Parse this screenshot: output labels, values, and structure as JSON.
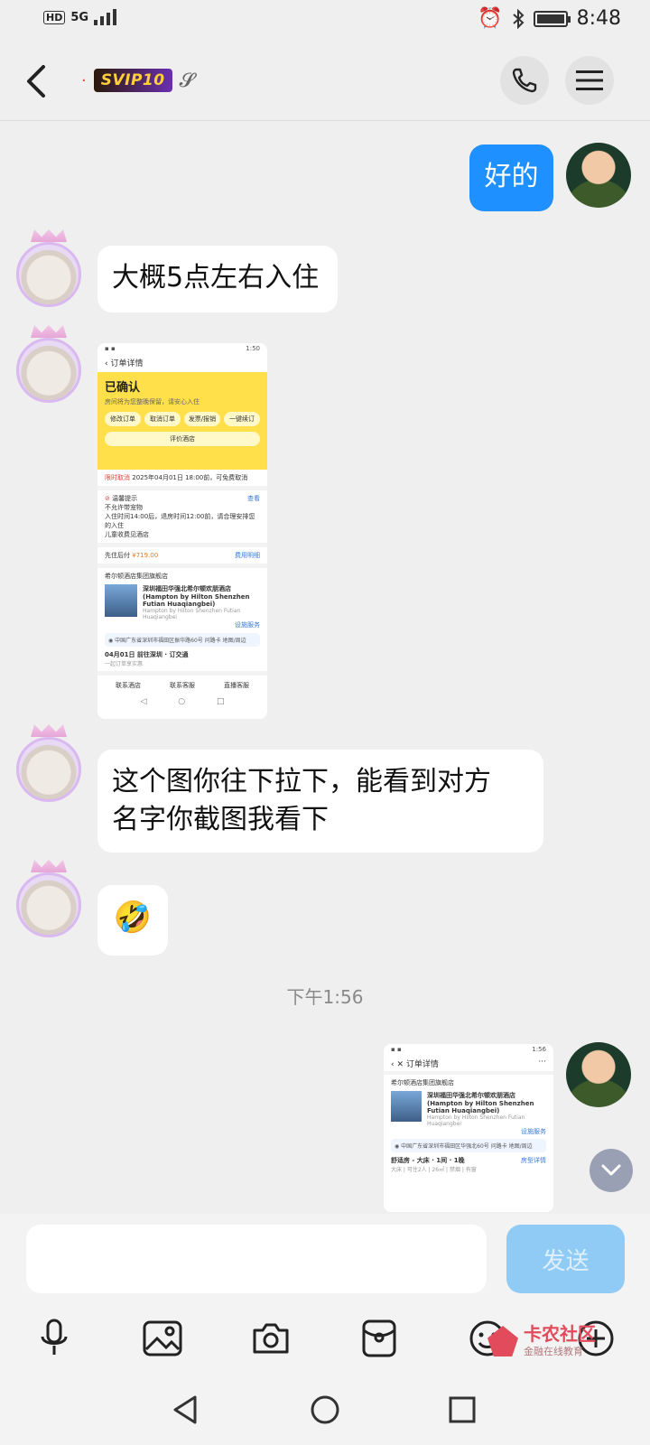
{
  "status_bar": {
    "network": "HD",
    "signal": "5G",
    "time": "8:48",
    "battery_level": 0.9
  },
  "header": {
    "badge_text": "SVIP10",
    "badge_dot": "·"
  },
  "messages": [
    {
      "sender": "me",
      "text": "好的"
    },
    {
      "sender": "them",
      "text": "大概5点左右入住"
    },
    {
      "sender": "them",
      "type": "image"
    },
    {
      "sender": "them",
      "text_line1": "这个图你往下拉下，能看到对方",
      "text_line2": "名字你截图我看下"
    },
    {
      "sender": "them",
      "type": "emoji",
      "emoji": "🤣"
    }
  ],
  "timestamp": "下午1:56",
  "shot1": {
    "time": "1:50",
    "title": "订单详情",
    "status": "已确认",
    "note": "房间将为您整晚保留，请安心入住",
    "buttons": [
      "修改订单",
      "取消订单",
      "发票/报销",
      "一键续订"
    ],
    "review": "评价酒店",
    "cancel_label": "限时取消",
    "cancel_text": "2025年04月01日 18:00前，可免费取消",
    "tips_title": "温馨提示",
    "tips_more": "查看",
    "tip1": "不允许带宠物",
    "tip2": "入住时间14:00后，退房时间12:00前，请合理安排您的入住",
    "tip3": "儿童收费见酒店",
    "pay_label": "先住后付",
    "price": "¥719.00",
    "price_detail": "费用明细",
    "group": "希尔顿酒店集团旗舰店",
    "hotel_cn": "深圳福田华强北希尔顿欢朋酒店",
    "hotel_en": "(Hampton by Hilton Shenzhen Futian Huaqiangbei)",
    "hotel_en_sub": "Hampton by Hilton Shenzhen Futian Huaqiangbei",
    "service": "设施服务",
    "address": "中国广东省深圳市福田区振华路60号",
    "route": "问路卡",
    "map": "地图/周边",
    "trip": "04月01日 前往深圳 · 订交通",
    "trip_sub": "一起订单享实惠",
    "bottom": [
      "联系酒店",
      "联系客服",
      "直播客服"
    ]
  },
  "shot2": {
    "time": "1:56",
    "title": "订单详情",
    "group": "希尔顿酒店集团旗舰店",
    "hotel_cn": "深圳福田华强北希尔顿欢朋酒店",
    "hotel_en": "(Hampton by Hilton Shenzhen Futian Huaqiangbei)",
    "hotel_en_sub": "Hampton by Hilton Shenzhen Futian Huaqiangbei",
    "service": "设施服务",
    "address": "中国广东省深圳市福田区华强北60号",
    "route": "问路卡",
    "map": "地图/周边",
    "room": "舒适房 - 大床 · 1间 · 1晚",
    "room_detail": "房型详情",
    "room_sub": "大床 | 可住2人 | 26㎡ | 禁烟 | 有窗"
  },
  "composer": {
    "send_label": "发送",
    "input_value": ""
  },
  "watermark": {
    "title": "卡农社区",
    "subtitle": "金融在线教育"
  },
  "colors": {
    "accent": "#1e90ff",
    "send_disabled": "#8fcbf5",
    "background": "#efefef"
  }
}
